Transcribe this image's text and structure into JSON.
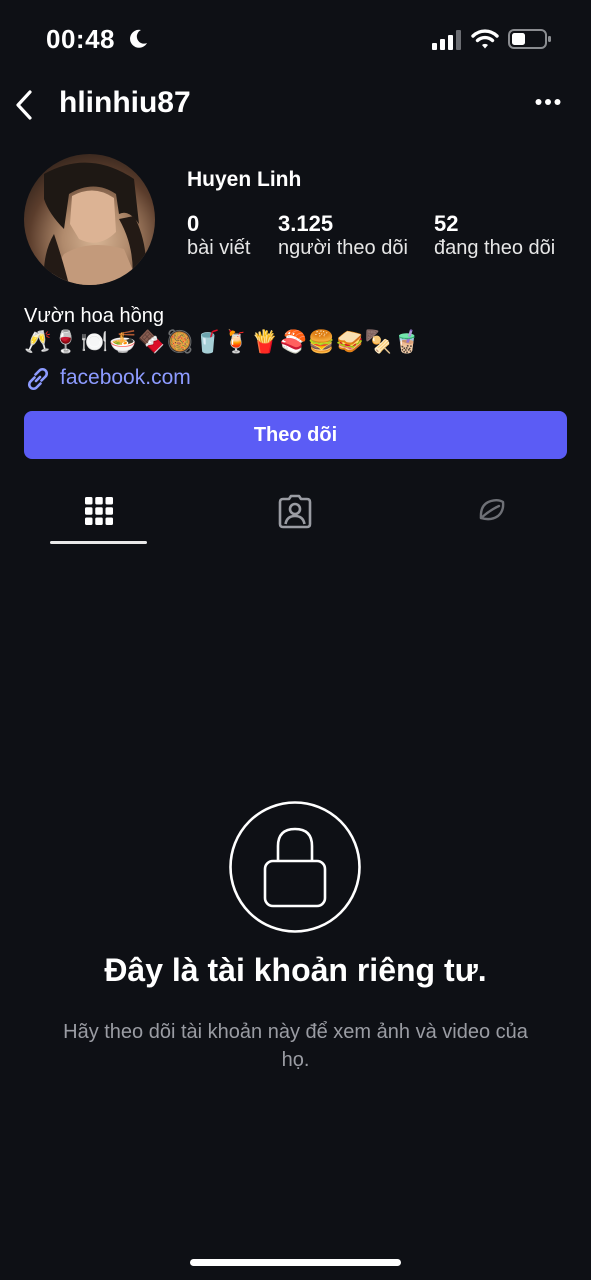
{
  "status_bar": {
    "time": "00:48",
    "moon_icon": "moon-icon",
    "signal_icon": "cellular-signal-icon",
    "wifi_icon": "wifi-icon",
    "battery_icon": "battery-icon"
  },
  "header": {
    "username": "hlinhiu87",
    "back_icon": "chevron-left-icon",
    "more_icon": "more-horizontal-icon"
  },
  "profile": {
    "name": "Huyen Linh",
    "stats": [
      {
        "value": "0",
        "label": "bài viết"
      },
      {
        "value": "3.125",
        "label": "người theo dõi"
      },
      {
        "value": "52",
        "label": "đang theo dõi"
      }
    ],
    "bio": "Vườn hoa hồng",
    "bio_emoji": "🥂🍷🍽️🍜🍫🥘🥤🍹🍟🍣🍔🥪🍢🧋",
    "link": "facebook.com",
    "link_icon": "link-icon"
  },
  "actions": {
    "follow_label": "Theo dõi"
  },
  "tabs": [
    {
      "icon": "grid-icon",
      "active": true
    },
    {
      "icon": "tagged-user-icon",
      "active": false
    },
    {
      "icon": "leaf-icon",
      "active": false
    }
  ],
  "private_notice": {
    "icon": "lock-icon",
    "title": "Đây là tài khoản riêng tư.",
    "description": "Hãy theo dõi tài khoản này để xem ảnh và video của họ."
  },
  "colors": {
    "background": "#0e1015",
    "accent": "#5b5cf5",
    "link": "#8d9bff",
    "muted": "#9a9ca3"
  }
}
